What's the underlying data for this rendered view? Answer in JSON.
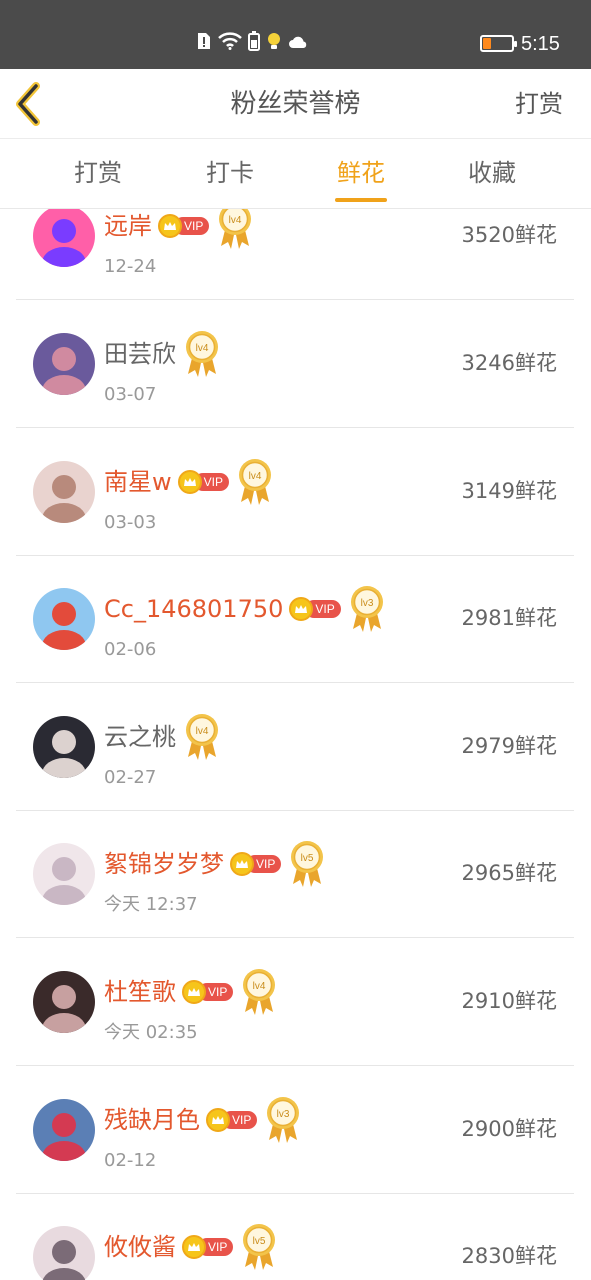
{
  "status_bar": {
    "time": "5:15",
    "battery_level": 0.3,
    "icons": [
      "alert-icon",
      "wifi-icon",
      "battery-saver-icon",
      "bulb-icon",
      "cloud-icon"
    ]
  },
  "header": {
    "title": "粉丝荣誉榜",
    "action": "打赏"
  },
  "tabs": [
    {
      "label": "打赏",
      "active": false
    },
    {
      "label": "打卡",
      "active": false
    },
    {
      "label": "鲜花",
      "active": true
    },
    {
      "label": "收藏",
      "active": false
    }
  ],
  "colors": {
    "accent": "#f0a21a",
    "vip_name": "#e3582e",
    "vip_pill": "#e8534a"
  },
  "vip_label": "VIP",
  "fans": [
    {
      "name": "远岸",
      "vip": true,
      "level": "lv4",
      "date": "12-24",
      "amount": "3520鲜花"
    },
    {
      "name": "田芸欣",
      "vip": false,
      "level": "lv4",
      "date": "03-07",
      "amount": "3246鲜花"
    },
    {
      "name": "南星w",
      "vip": true,
      "level": "lv4",
      "date": "03-03",
      "amount": "3149鲜花"
    },
    {
      "name": "Cc_146801750",
      "vip": true,
      "level": "lv3",
      "date": "02-06",
      "amount": "2981鲜花"
    },
    {
      "name": "云之桃",
      "vip": false,
      "level": "lv4",
      "date": "02-27",
      "amount": "2979鲜花"
    },
    {
      "name": "絮锦岁岁梦",
      "vip": true,
      "level": "lv5",
      "date": "今天 12:37",
      "amount": "2965鲜花"
    },
    {
      "name": "杜笙歌",
      "vip": true,
      "level": "lv4",
      "date": "今天 02:35",
      "amount": "2910鲜花"
    },
    {
      "name": "残缺月色",
      "vip": true,
      "level": "lv3",
      "date": "02-12",
      "amount": "2900鲜花"
    },
    {
      "name": "攸攸酱",
      "vip": true,
      "level": "lv5",
      "date": "",
      "amount": "2830鲜花"
    }
  ]
}
